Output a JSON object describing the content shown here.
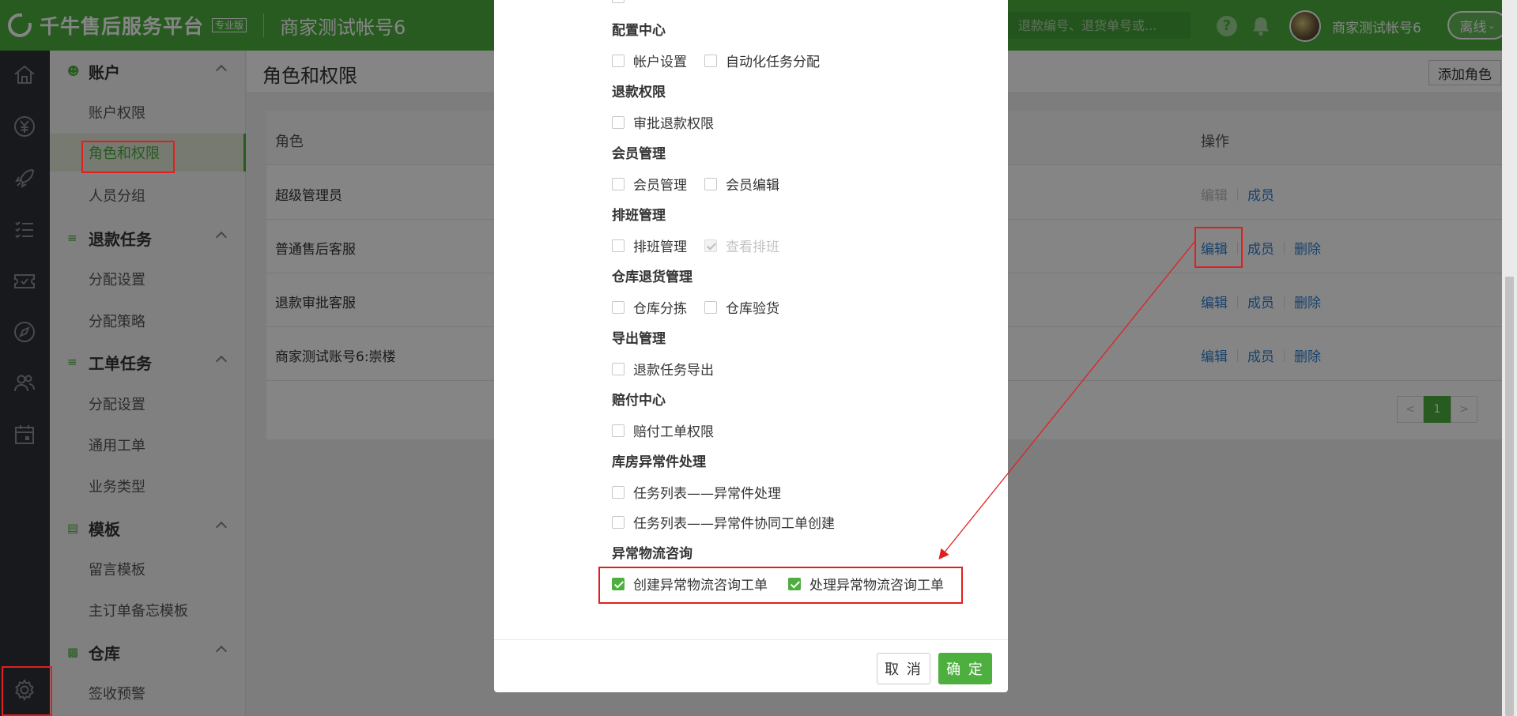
{
  "header": {
    "logo_text": "千牛售后服务平台",
    "edition_badge": "专业版",
    "account_title": "商家测试帐号6",
    "search_placeholder": "退款编号、退货单号或...",
    "help_label": "?",
    "user_name": "商家测试帐号6",
    "status_label": "离线"
  },
  "rail_icons": [
    "home-icon",
    "yen-icon",
    "rocket-icon",
    "checklist-icon",
    "ticket-icon",
    "compass-icon",
    "users-icon",
    "calendar-icon",
    "gear-icon"
  ],
  "sidebar": {
    "groups": [
      {
        "label": "账户",
        "items": [
          "账户权限",
          "角色和权限",
          "人员分组"
        ]
      },
      {
        "label": "退款任务",
        "items": [
          "分配设置",
          "分配策略"
        ]
      },
      {
        "label": "工单任务",
        "items": [
          "分配设置",
          "通用工单",
          "业务类型"
        ]
      },
      {
        "label": "模板",
        "items": [
          "留言模板",
          "主订单备忘模板"
        ]
      },
      {
        "label": "仓库",
        "items": [
          "签收预警"
        ]
      }
    ],
    "active_item": "角色和权限"
  },
  "page": {
    "title": "角色和权限",
    "add_button": "添加角色",
    "table": {
      "columns": [
        "角色",
        "操作"
      ],
      "rows": [
        {
          "role": "超级管理员",
          "ops": [
            "编辑",
            "成员"
          ]
        },
        {
          "role": "普通售后客服",
          "ops": [
            "编辑",
            "成员",
            "删除"
          ]
        },
        {
          "role": "退款审批客服",
          "ops": [
            "编辑",
            "成员",
            "删除"
          ]
        },
        {
          "role": "商家测试账号6:崇楼",
          "ops": [
            "编辑",
            "成员",
            "删除"
          ]
        }
      ]
    },
    "pagination": {
      "prev": "<",
      "current": "1",
      "next": ">"
    }
  },
  "modal": {
    "sections": [
      {
        "title": "配置中心",
        "options": [
          {
            "label": "帐户设置",
            "checked": false
          },
          {
            "label": "自动化任务分配",
            "checked": false
          }
        ]
      },
      {
        "title": "退款权限",
        "options": [
          {
            "label": "审批退款权限",
            "checked": false
          }
        ]
      },
      {
        "title": "会员管理",
        "options": [
          {
            "label": "会员管理",
            "checked": false
          },
          {
            "label": "会员编辑",
            "checked": false
          }
        ]
      },
      {
        "title": "排班管理",
        "options": [
          {
            "label": "排班管理",
            "checked": false
          },
          {
            "label": "查看排班",
            "checked": true,
            "disabled": true
          }
        ]
      },
      {
        "title": "仓库退货管理",
        "options": [
          {
            "label": "仓库分拣",
            "checked": false
          },
          {
            "label": "仓库验货",
            "checked": false
          }
        ]
      },
      {
        "title": "导出管理",
        "options": [
          {
            "label": "退款任务导出",
            "checked": false
          }
        ]
      },
      {
        "title": "赔付中心",
        "options": [
          {
            "label": "赔付工单权限",
            "checked": false
          }
        ]
      },
      {
        "title": "库房异常件处理",
        "options": [
          {
            "label": "任务列表——异常件处理",
            "checked": false
          },
          {
            "label": "任务列表——异常件协同工单创建",
            "checked": false
          }
        ]
      },
      {
        "title": "异常物流咨询",
        "options": [
          {
            "label": "创建异常物流咨询工单",
            "checked": true
          },
          {
            "label": "处理异常物流咨询工单",
            "checked": true
          }
        ]
      }
    ],
    "cancel_label": "取 消",
    "confirm_label": "确 定"
  },
  "colors": {
    "brand_green": "#4caf3e",
    "link_blue": "#2f7fd0",
    "annotation_red": "#e02020",
    "rail_dark": "#2d3038"
  }
}
